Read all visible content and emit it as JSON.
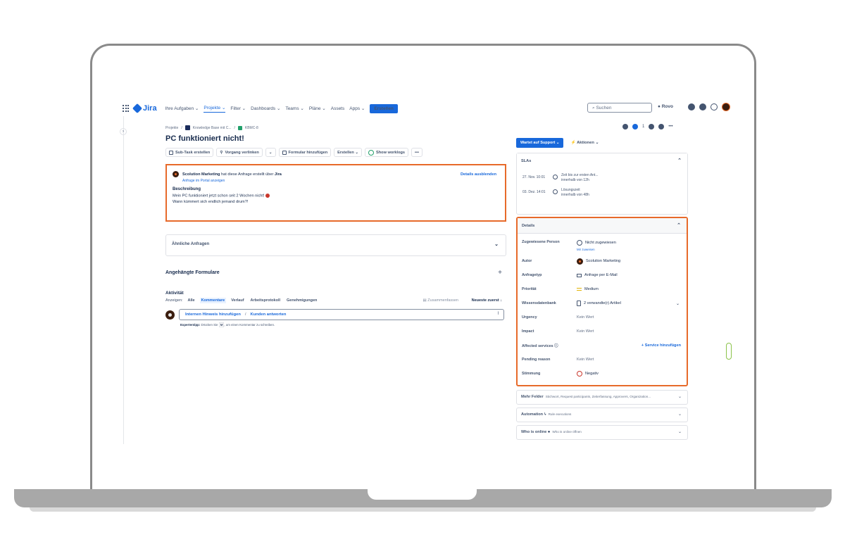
{
  "app": {
    "logo": "Jira"
  },
  "nav": {
    "items": [
      "Ihre Aufgaben ⌄",
      "Projekte ⌄",
      "Filter ⌄",
      "Dashboards ⌄",
      "Teams ⌄",
      "Pläne ⌄",
      "Assets",
      "Apps ⌄"
    ],
    "active_index": 1,
    "create": "Erstellen",
    "search_placeholder": "Suchen",
    "rovo": "Rovo"
  },
  "breadcrumb": {
    "projects": "Projekte",
    "sep": "/",
    "project": "Knowledge Base mit C...",
    "issue": "KBMC-8"
  },
  "issue": {
    "title": "PC funktioniert nicht!"
  },
  "toolbar": {
    "subtask": "Sub-Task erstellen",
    "link": "Vorgang verlinken",
    "form": "Formular hinzufügen",
    "create": "Erstellen ⌄",
    "worklogs": "Show worklogs",
    "more": "•••"
  },
  "request": {
    "author": "Scolution Marketing",
    "via_text": "hat diese Anfrage erstellt über",
    "via": "Jira",
    "portal_link": "Anfrage im Portal anzeigen",
    "hide_details": "Details ausblenden",
    "desc_label": "Beschreibung",
    "desc_line1": "Mein PC funktioniert jetzt schon seit 2 Wochen nicht!",
    "desc_line2": "Wann kümmert sich endlich jemand drum?!"
  },
  "similar": {
    "label": "Ähnliche Anfragen"
  },
  "forms": {
    "label": "Angehängte Formulare"
  },
  "activity": {
    "title": "Aktivität",
    "show_label": "Anzeigen:",
    "filters": [
      "Alle",
      "Kommentare",
      "Verlauf",
      "Arbeitsprotokoll",
      "Genehmigungen"
    ],
    "selected_index": 1,
    "summarize": "Zusammenfassen",
    "sort": "Neueste zuerst ↓",
    "internal_note": "Internen Hinweis hinzufügen",
    "sep": "/",
    "reply": "Kunden antworten",
    "tip_bold": "Expertentipp:",
    "tip_text1": "Drücken Sie",
    "tip_key": "M",
    "tip_text2": ", um einen Kommentar zu schreiben."
  },
  "status": {
    "label": "Wartet auf Support ⌄",
    "actions": "Aktionen ⌄",
    "watchers": "1"
  },
  "sla": {
    "title": "SLAs",
    "rows": [
      {
        "date": "27. Nov. 10:01",
        "name": "Zeit bis zur ersten Ant...",
        "remaining": "innerhalb von 12h"
      },
      {
        "date": "03. Dez. 14:01",
        "name": "Lösungszeit",
        "remaining": "innerhalb von 48h"
      }
    ]
  },
  "details": {
    "title": "Details",
    "assignee_label": "Zugewiesene Person",
    "assignee_value": "Nicht zugewiesen",
    "assign_me": "Mir zuweisen",
    "author_label": "Autor",
    "author_value": "Scolution Marketing",
    "type_label": "Anfragetyp",
    "type_value": "Anfrage per E-Mail",
    "priority_label": "Priorität",
    "priority_value": "Medium",
    "kb_label": "Wissensdatenbank",
    "kb_value": "2 verwandte(r) Artikel",
    "urgency_label": "Urgency",
    "urgency_value": "Kein Wert",
    "impact_label": "Impact",
    "impact_value": "Kein Wert",
    "affected_label": "Affected services ⓘ",
    "affected_action": "+ Service hinzufügen",
    "pending_label": "Pending reason",
    "pending_value": "Kein Wert",
    "mood_label": "Stimmung",
    "mood_value": "Negativ"
  },
  "more_fields": {
    "label": "Mehr Felder",
    "sub": "Stichwort, Request participants, Zeiterfassung, Approvers, Organization..."
  },
  "automation": {
    "label": "Automation",
    "sub": "Rule executions"
  },
  "online": {
    "label": "Who is online",
    "sub": "Who is online öffnen"
  },
  "colors": {
    "accent": "#1868db",
    "highlight": "#e76a2a"
  }
}
